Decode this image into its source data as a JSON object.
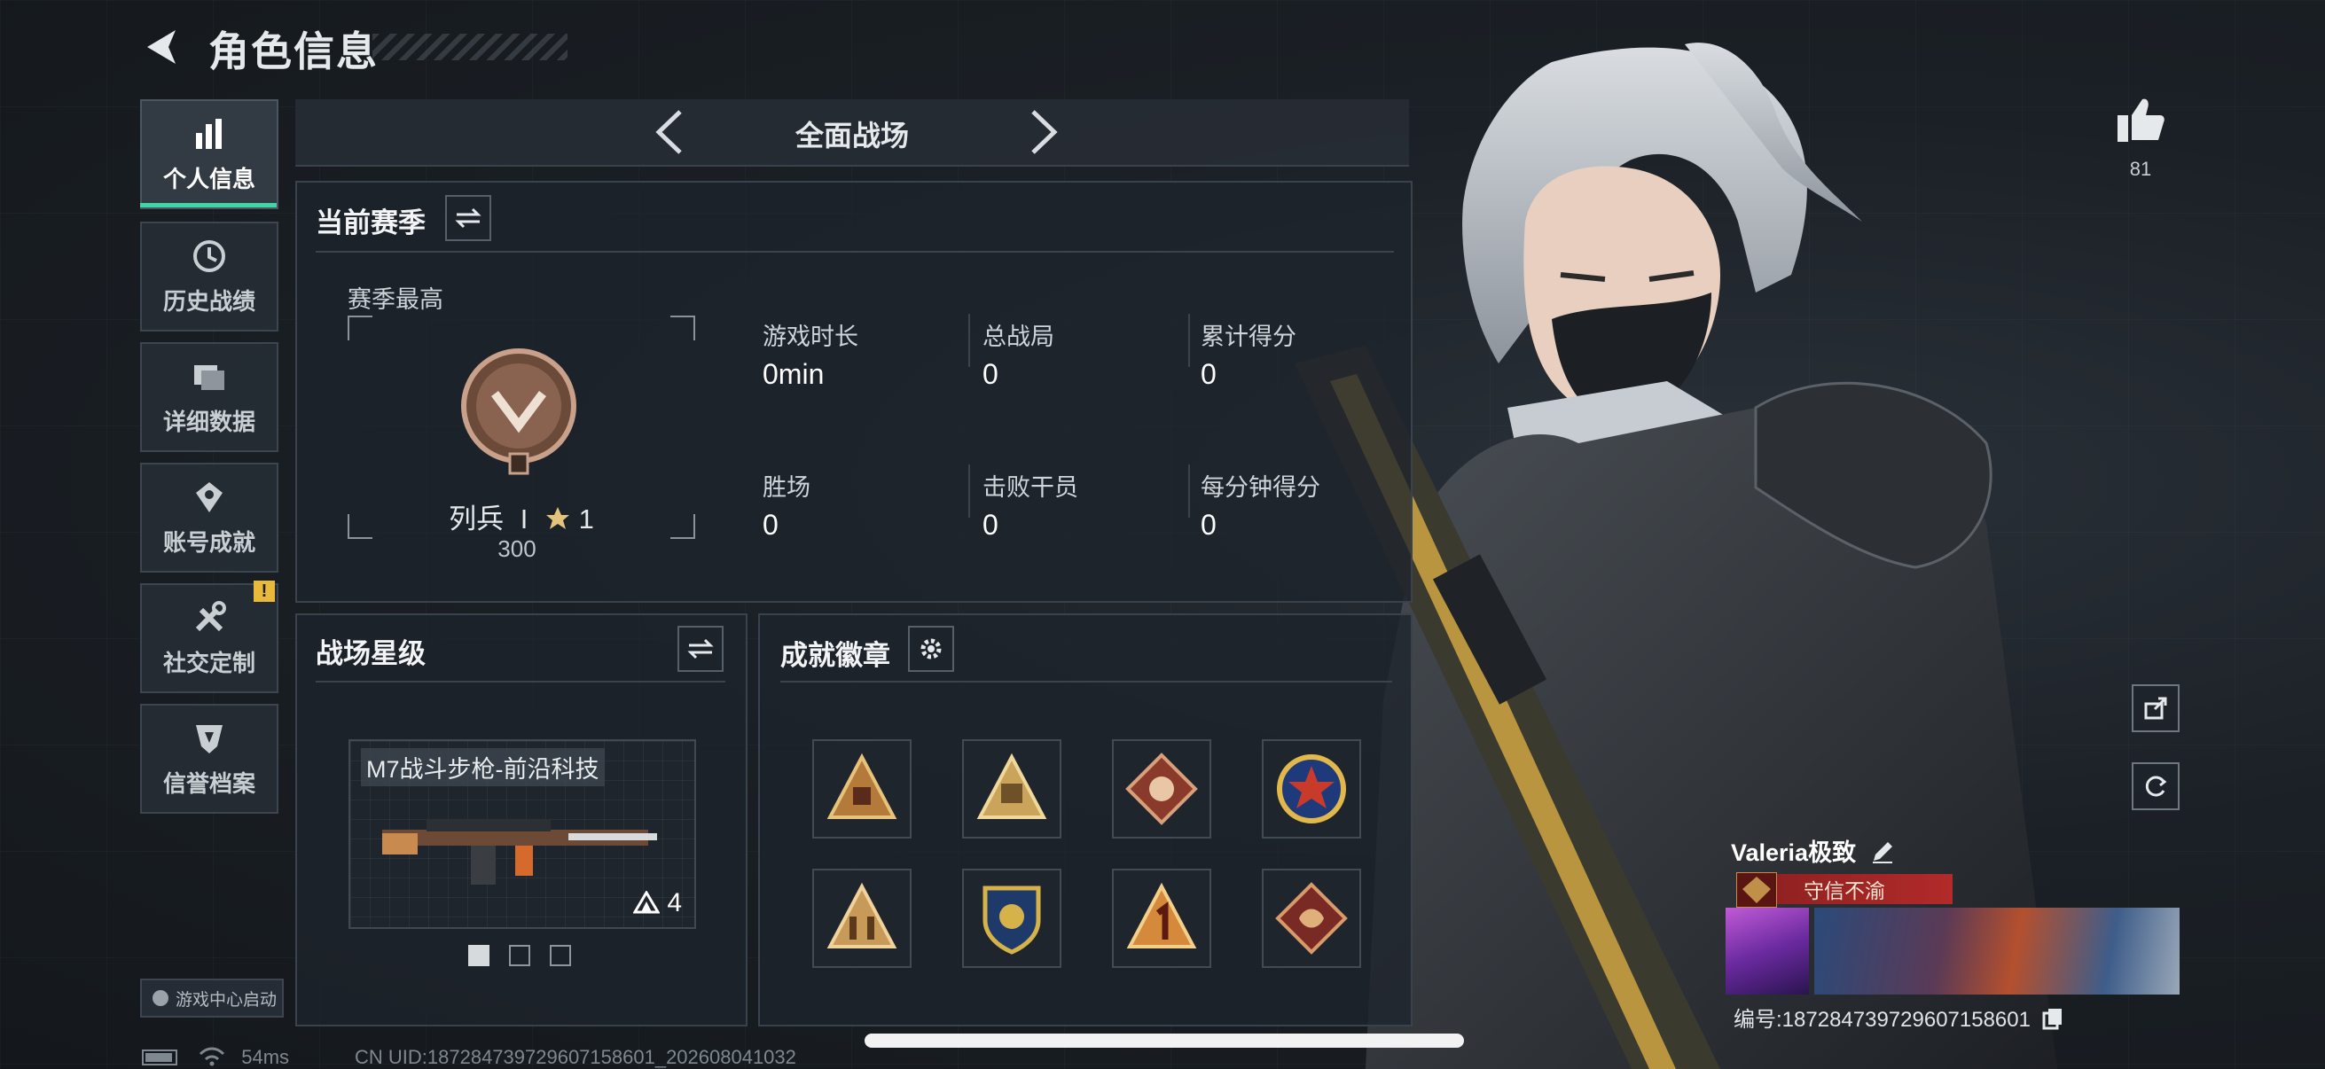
{
  "header": {
    "title": "角色信息"
  },
  "sidebar": {
    "items": [
      {
        "label": "个人信息",
        "icon": "bar-chart-icon",
        "active": true
      },
      {
        "label": "历史战绩",
        "icon": "history-clock-icon"
      },
      {
        "label": "详细数据",
        "icon": "folder-data-icon"
      },
      {
        "label": "账号成就",
        "icon": "achievement-icon"
      },
      {
        "label": "社交定制",
        "icon": "tools-icon",
        "alert": "!"
      },
      {
        "label": "信誉档案",
        "icon": "reputation-shield-icon"
      }
    ],
    "launch_label": "游戏中心启动"
  },
  "mode_selector": {
    "title": "全面战场"
  },
  "season": {
    "title": "当前赛季",
    "best_label": "赛季最高",
    "rank_name": "列兵",
    "rank_tier": "I",
    "stars": "1",
    "points": "300",
    "stats": [
      {
        "label": "游戏时长",
        "value": "0min"
      },
      {
        "label": "总战局",
        "value": "0"
      },
      {
        "label": "累计得分",
        "value": "0"
      },
      {
        "label": "胜场",
        "value": "0"
      },
      {
        "label": "击败干员",
        "value": "0"
      },
      {
        "label": "每分钟得分",
        "value": "0"
      }
    ]
  },
  "battlefield_stars": {
    "title": "战场星级",
    "weapon_name": "M7战斗步枪-前沿科技",
    "star_level": "4",
    "pages": 3,
    "active_page": 0
  },
  "achievements": {
    "title": "成就徽章",
    "badges": [
      "triangle-medal-icon",
      "triangle-emblem-icon",
      "wolf-diamond-icon",
      "star-seal-icon",
      "soldiers-triangle-icon",
      "shield-crest-icon",
      "number-one-triangle-icon",
      "dragon-diamond-icon"
    ]
  },
  "profile": {
    "likes": "81",
    "player_name": "Valeria极致",
    "title_tag": "守信不渝",
    "uid_label": "编号:",
    "uid": "187284739729607158601"
  },
  "footer": {
    "ping": "54ms",
    "cn_uid": "CN UID:187284739729607158601_202608041032"
  },
  "colors": {
    "accent": "#3fd6a7",
    "alert": "#e8b93a",
    "title_tag": "#b22a2a"
  }
}
